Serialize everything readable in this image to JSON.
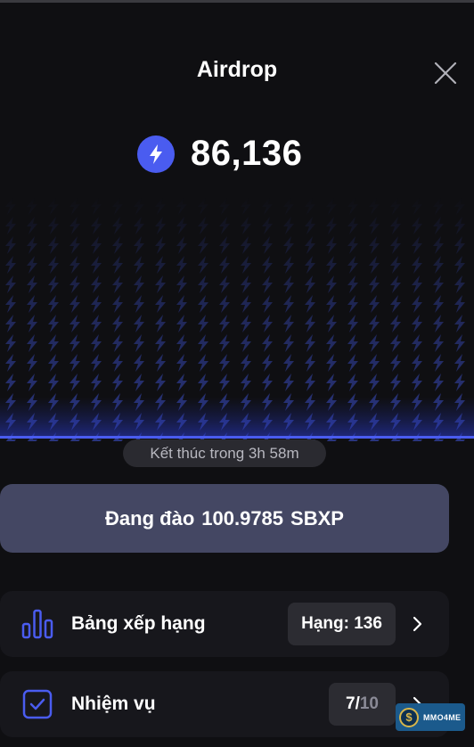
{
  "header": {
    "title": "Airdrop",
    "close_icon": "close-icon"
  },
  "balance": {
    "icon": "lightning-bolt-icon",
    "value": "86,136",
    "icon_color": "#4a5cf0"
  },
  "timer": {
    "text": "Kết thúc trong 3h 58m"
  },
  "mining": {
    "label": "Đang đào",
    "amount": "100.9785",
    "currency": "SBXP"
  },
  "leaderboard": {
    "icon": "bar-chart-icon",
    "label": "Bảng xếp hạng",
    "rank_text": "Hạng: 136",
    "chevron": "chevron-right-icon"
  },
  "tasks": {
    "icon": "checkbox-icon",
    "label": "Nhiệm vụ",
    "done": "7/",
    "total": "10",
    "chevron": "chevron-right-icon"
  },
  "watermark": {
    "text": "MMO4ME"
  },
  "colors": {
    "accent": "#4a5cf0",
    "background": "#0f0f12",
    "button": "#444763",
    "card": "#17171c"
  }
}
